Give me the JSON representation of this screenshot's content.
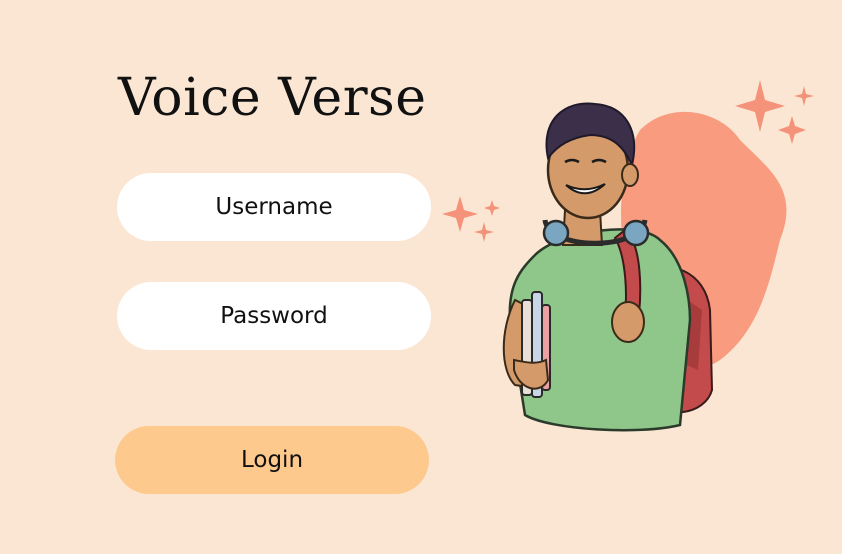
{
  "app": {
    "title": "Voice Verse"
  },
  "form": {
    "username_placeholder": "Username",
    "password_placeholder": "Password",
    "login_label": "Login"
  },
  "colors": {
    "background": "#fbe6d4",
    "field_bg": "#ffffff",
    "button_bg": "#fec98d",
    "accent_blob": "#f89b7e"
  },
  "illustration": {
    "icon": "student-with-backpack-icon"
  }
}
